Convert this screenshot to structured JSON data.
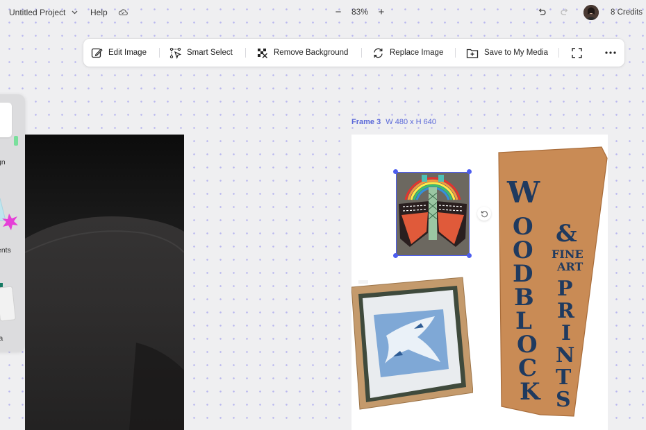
{
  "header": {
    "project_name": "Untitled Project",
    "help_label": "Help",
    "zoom_value": "83%",
    "zoom_out_symbol": "−",
    "zoom_in_symbol": "+",
    "credits": "8 Credits"
  },
  "toolbar": {
    "edit_image": "Edit Image",
    "smart_select": "Smart Select",
    "remove_background": "Remove Background",
    "replace_image": "Replace Image",
    "save_to_media": "Save to My Media"
  },
  "left_panel": {
    "items": [
      {
        "label": "gn",
        "icon": "design-icon"
      },
      {
        "label": "ents",
        "icon": "elements-icon"
      },
      {
        "label": "ia",
        "icon": "media-icon"
      }
    ]
  },
  "frame": {
    "name": "Frame 3",
    "size": "W 480 x H 640"
  },
  "artwork": {
    "sign_left": [
      "W",
      "O",
      "O",
      "D",
      "B",
      "L",
      "O",
      "C",
      "K"
    ],
    "sign_right_top": "&",
    "sign_fine": "FINE",
    "sign_art": "ART",
    "sign_right": [
      "P",
      "R",
      "I",
      "N",
      "T",
      "S"
    ]
  },
  "colors": {
    "accent": "#4d5ef0",
    "frame_label": "#5a68d8",
    "canvas_bg": "#efeff1",
    "dot_grid": "#b9b7ef"
  },
  "icons": [
    "chevron-down-icon",
    "cloud-icon",
    "undo-icon",
    "redo-icon",
    "edit-image-icon",
    "smart-select-icon",
    "remove-background-icon",
    "replace-image-icon",
    "save-media-icon",
    "fullscreen-icon",
    "more-icon",
    "rotate-icon"
  ]
}
